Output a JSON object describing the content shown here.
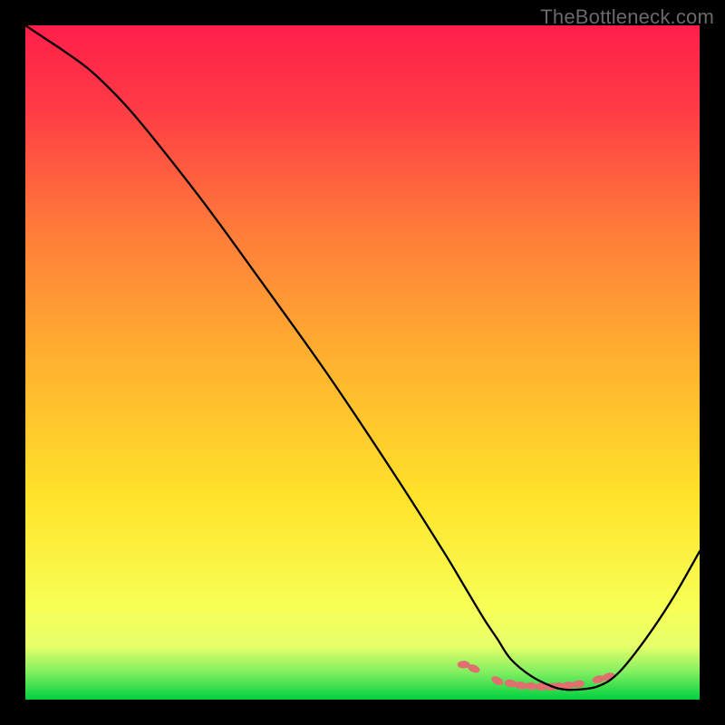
{
  "watermark": "TheBottleneck.com",
  "chart_data": {
    "type": "line",
    "title": "",
    "xlabel": "",
    "ylabel": "",
    "xlim": [
      0,
      100
    ],
    "ylim": [
      0,
      100
    ],
    "grid": false,
    "legend": false,
    "background_gradient": {
      "top_color": "#ff1e4a",
      "mid_color": "#ffe22a",
      "bottom_green_start": "#e8ff6a",
      "bottom_green_end": "#00d040"
    },
    "series": [
      {
        "name": "bottleneck-curve",
        "type": "line",
        "color": "#000000",
        "x": [
          0,
          3,
          6,
          10,
          15,
          20,
          27,
          35,
          45,
          55,
          62,
          65,
          68,
          70,
          72,
          75,
          78,
          80,
          82,
          85,
          88,
          92,
          96,
          100
        ],
        "y": [
          100,
          98,
          96,
          93,
          88,
          82,
          73,
          62,
          48,
          33,
          22,
          17,
          12,
          9,
          6,
          3.5,
          2,
          1.5,
          1.5,
          2,
          4,
          9,
          15,
          22
        ]
      },
      {
        "name": "optimal-zone-markers",
        "type": "scatter",
        "color": "#e07070",
        "marker_shape": "lozenge",
        "x": [
          65,
          66.5,
          70,
          72,
          73.5,
          75,
          76.5,
          78,
          79,
          80.5,
          82,
          85,
          86.5
        ],
        "y": [
          5.2,
          4.6,
          2.8,
          2.4,
          2.1,
          2.0,
          1.9,
          1.9,
          2.0,
          2.1,
          2.3,
          3.0,
          3.4
        ]
      }
    ]
  }
}
